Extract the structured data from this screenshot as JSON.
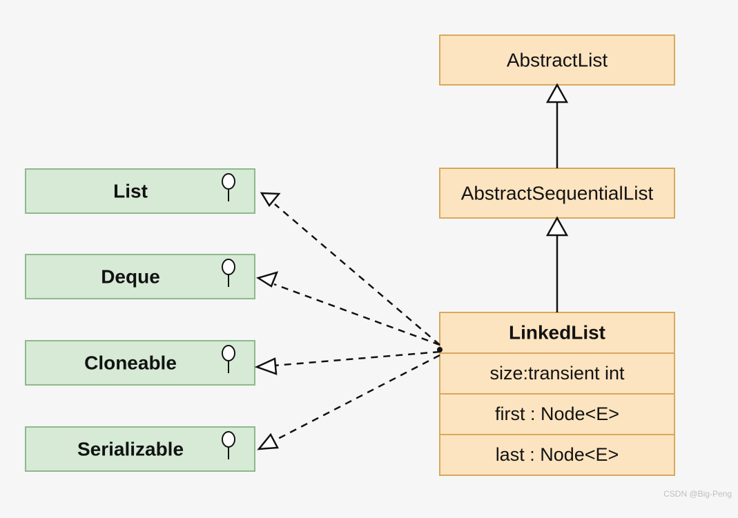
{
  "interfaces": {
    "list": {
      "label": "List"
    },
    "deque": {
      "label": "Deque"
    },
    "cloneable": {
      "label": "Cloneable"
    },
    "serializable": {
      "label": "Serializable"
    }
  },
  "classes": {
    "abstractList": {
      "label": "AbstractList"
    },
    "abstractSequentialList": {
      "label": "AbstractSequentialList"
    },
    "linkedList": {
      "name": "LinkedList",
      "fields": {
        "size": "size:transient int",
        "first": "first : Node<E>",
        "last": "last : Node<E>"
      }
    }
  },
  "watermark": "CSDN @Big-Peng",
  "colors": {
    "interfaceFill": "#d6ead6",
    "interfaceStroke": "#8cb98c",
    "classFill": "#fde4c0",
    "classStroke": "#d7a85c",
    "background": "#f6f6f6",
    "line": "#111111"
  }
}
